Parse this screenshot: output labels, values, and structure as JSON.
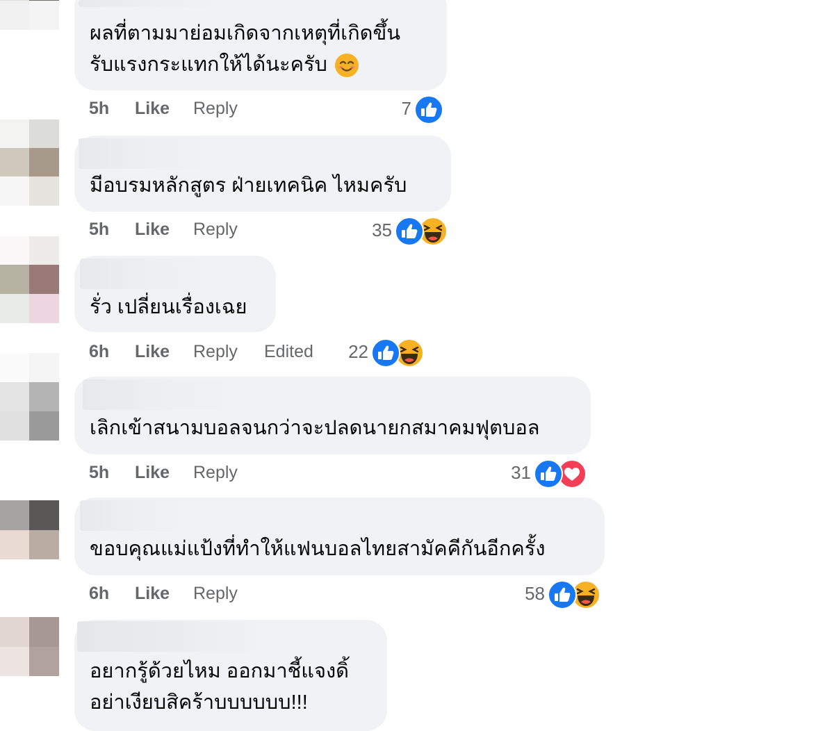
{
  "comments": [
    {
      "lines": [
        "ผลที่ตามมาย่อมเกิดจากเหตุที่เกิดขึ้น",
        "รับแรงกระแทกให้ได้นะครับ"
      ],
      "emoji": "smiling-face-emoji",
      "time": "5h",
      "like": "Like",
      "reply": "Reply",
      "edited": "",
      "count": "7",
      "reactions": [
        "like"
      ]
    },
    {
      "lines": [
        "มีอบรมหลักสูตร ฝ่ายเทคนิค ไหมครับ"
      ],
      "time": "5h",
      "like": "Like",
      "reply": "Reply",
      "edited": "",
      "count": "35",
      "reactions": [
        "like",
        "haha"
      ]
    },
    {
      "lines": [
        "รั่ว เปลี่ยนเรื่องเฉย"
      ],
      "time": "6h",
      "like": "Like",
      "reply": "Reply",
      "edited": "Edited",
      "count": "22",
      "reactions": [
        "like",
        "haha"
      ]
    },
    {
      "lines": [
        "เลิกเข้าสนามบอลจนกว่าจะปลดนายกสมาคมฟุตบอล"
      ],
      "time": "5h",
      "like": "Like",
      "reply": "Reply",
      "edited": "",
      "count": "31",
      "reactions": [
        "like",
        "love"
      ]
    },
    {
      "lines": [
        "ขอบคุณแม่แป้งที่ทำให้แฟนบอลไทยสามัคคีกันอีกครั้ง"
      ],
      "time": "6h",
      "like": "Like",
      "reply": "Reply",
      "edited": "",
      "count": "58",
      "reactions": [
        "like",
        "haha"
      ]
    },
    {
      "lines": [
        "อยากรู้ด้วยไหม ออกมาชี้แจงดิ้",
        "อย่าเงียบสิคร้าบบบบบบ!!!"
      ],
      "time": "",
      "like": "",
      "reply": "",
      "edited": "",
      "count": "",
      "reactions": []
    }
  ],
  "colors": {
    "bubble": "#f0f2f5",
    "meta_text": "#65676b",
    "like_blue": "#1877f2",
    "love_red": "#f33e58",
    "haha_yellow": "#f7b125"
  }
}
